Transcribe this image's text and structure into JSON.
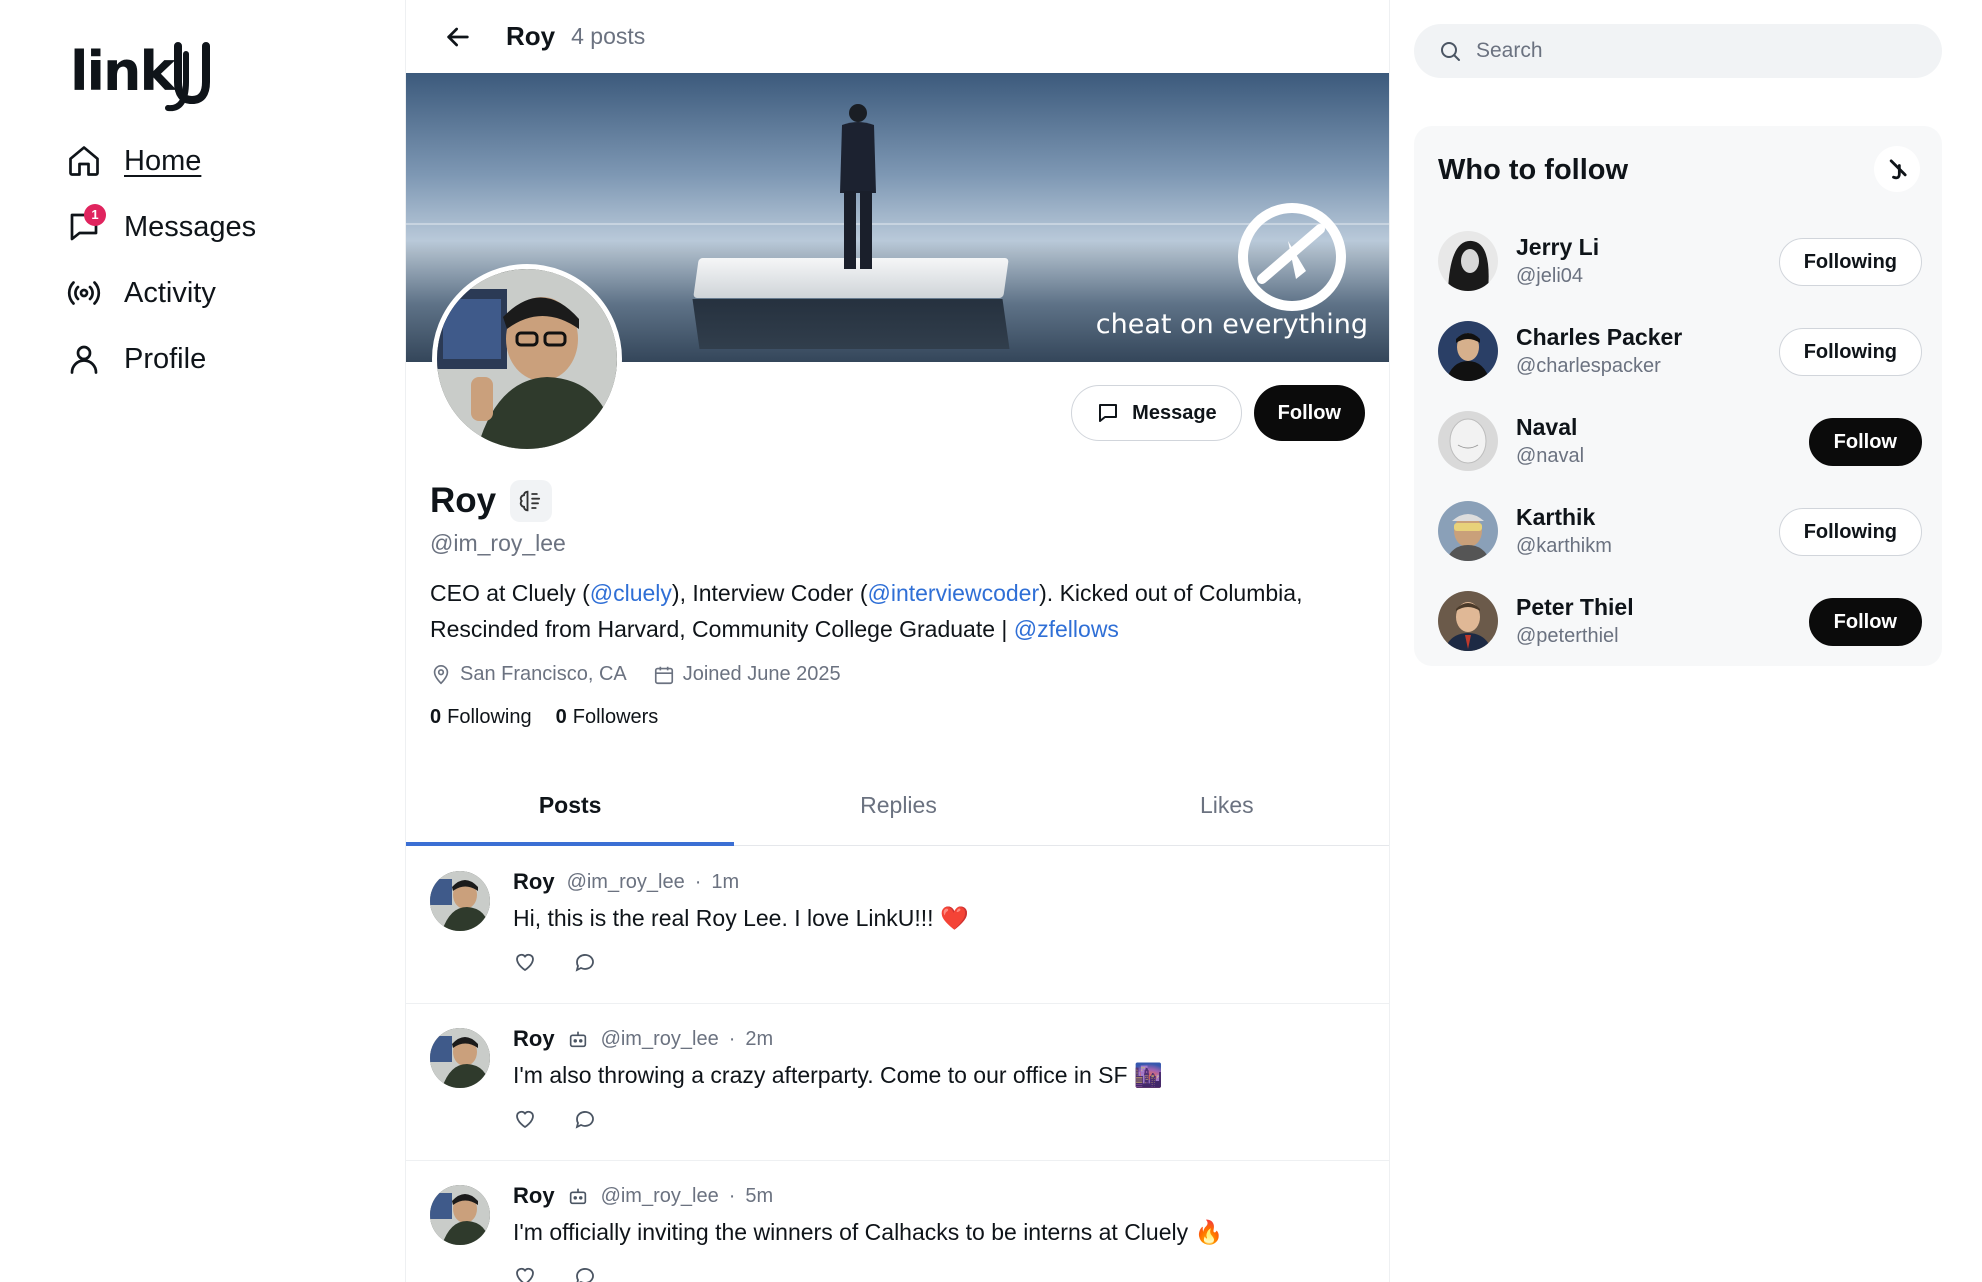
{
  "nav": {
    "logo_text": "linkU",
    "items": [
      {
        "label": "Home",
        "icon": "home-icon"
      },
      {
        "label": "Messages",
        "icon": "chat-icon",
        "badge": "1"
      },
      {
        "label": "Activity",
        "icon": "broadcast-icon"
      },
      {
        "label": "Profile",
        "icon": "user-icon"
      }
    ]
  },
  "header": {
    "name": "Roy",
    "post_count": "4 posts"
  },
  "banner": {
    "tagline": "cheat on everything"
  },
  "profile": {
    "name": "Roy",
    "handle": "@im_roy_lee",
    "bio": {
      "p1": "CEO at Cluely (",
      "l1": "@cluely",
      "p2": "), Interview Coder (",
      "l2": "@interviewcoder",
      "p3": "). Kicked out of Columbia, Rescinded from Harvard, Community College Graduate | ",
      "l3": "@zfellows"
    },
    "location": "San Francisco, CA",
    "joined": "Joined June 2025",
    "following_count": "0",
    "following_label": "Following",
    "followers_count": "0",
    "followers_label": "Followers",
    "message_label": "Message",
    "follow_label": "Follow"
  },
  "tabs": [
    "Posts",
    "Replies",
    "Likes"
  ],
  "posts": [
    {
      "author": "Roy",
      "handle": "@im_roy_lee",
      "time": "1m",
      "text": "Hi, this is the real Roy Lee. I love LinkU!!! ❤️",
      "bot": false
    },
    {
      "author": "Roy",
      "handle": "@im_roy_lee",
      "time": "2m",
      "text": "I'm also throwing a crazy afterparty. Come to our office in SF 🌆",
      "bot": true
    },
    {
      "author": "Roy",
      "handle": "@im_roy_lee",
      "time": "5m",
      "text": "I'm officially inviting the winners of Calhacks to be interns at Cluely 🔥",
      "bot": true
    }
  ],
  "search": {
    "placeholder": "Search"
  },
  "who_to_follow": {
    "title": "Who to follow",
    "users": [
      {
        "name": "Jerry Li",
        "handle": "@jeli04",
        "button": "Following",
        "state": "following"
      },
      {
        "name": "Charles Packer",
        "handle": "@charlespacker",
        "button": "Following",
        "state": "following"
      },
      {
        "name": "Naval",
        "handle": "@naval",
        "button": "Follow",
        "state": "follow"
      },
      {
        "name": "Karthik",
        "handle": "@karthikm",
        "button": "Following",
        "state": "following"
      },
      {
        "name": "Peter Thiel",
        "handle": "@peterthiel",
        "button": "Follow",
        "state": "follow"
      }
    ]
  },
  "colors": {
    "accent": "#3b6fd4",
    "link": "#2f6fd6",
    "badge": "#e0245e"
  }
}
